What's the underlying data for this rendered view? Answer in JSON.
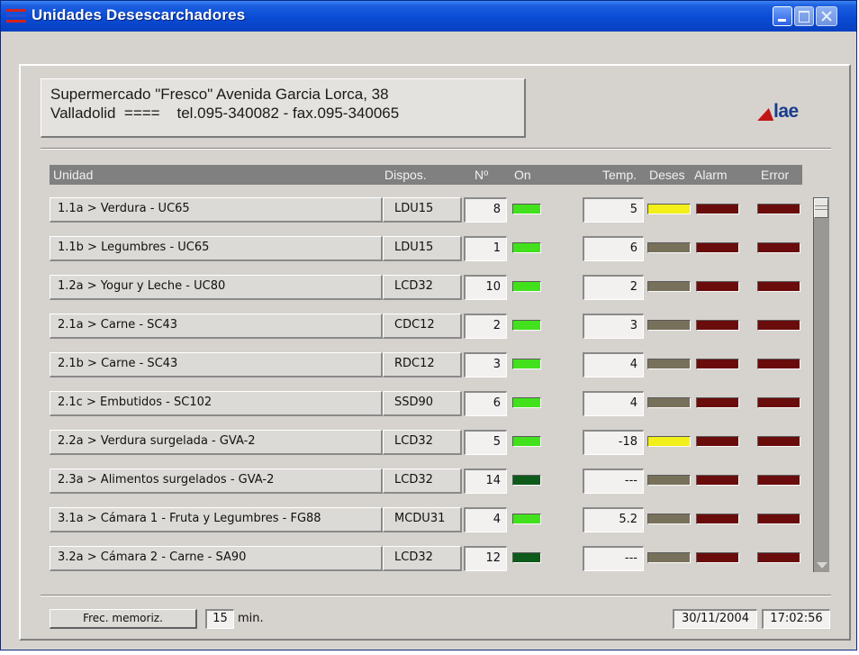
{
  "window": {
    "title": "Unidades Desescarchadores"
  },
  "address": {
    "line1": "Supermercado \"Fresco\" Avenida Garcia Lorca, 38",
    "line2": "Valladolid  ====    tel.095-340082 - fax.095-340065"
  },
  "logo": {
    "text": "lae"
  },
  "header": {
    "unidad": "Unidad",
    "dispos": "Dispos.",
    "num": "Nº",
    "on": "On",
    "temp": "Temp.",
    "deses": "Deses",
    "alarm": "Alarm",
    "error": "Error"
  },
  "colors": {
    "on": "#43e11d",
    "off": "#0d5a1a",
    "deses_on": "#f2ef1a",
    "deses_off": "#77705a",
    "alarm": "#6a0c0c",
    "error": "#6a0c0c"
  },
  "rows": [
    {
      "name": "1.1a > Verdura - UC65",
      "dispos": "LDU15",
      "num": "8",
      "on": true,
      "temp": "5",
      "deses": true
    },
    {
      "name": "1.1b > Legumbres - UC65",
      "dispos": "LDU15",
      "num": "1",
      "on": true,
      "temp": "6",
      "deses": false
    },
    {
      "name": "1.2a > Yogur y Leche - UC80",
      "dispos": "LCD32",
      "num": "10",
      "on": true,
      "temp": "2",
      "deses": false
    },
    {
      "name": "2.1a > Carne - SC43",
      "dispos": "CDC12",
      "num": "2",
      "on": true,
      "temp": "3",
      "deses": false
    },
    {
      "name": "2.1b > Carne - SC43",
      "dispos": "RDC12",
      "num": "3",
      "on": true,
      "temp": "4",
      "deses": false
    },
    {
      "name": "2.1c > Embutidos - SC102",
      "dispos": "SSD90",
      "num": "6",
      "on": true,
      "temp": "4",
      "deses": false
    },
    {
      "name": "2.2a > Verdura surgelada - GVA-2",
      "dispos": "LCD32",
      "num": "5",
      "on": true,
      "temp": "-18",
      "deses": true
    },
    {
      "name": "2.3a > Alimentos surgelados - GVA-2",
      "dispos": "LCD32",
      "num": "14",
      "on": false,
      "temp": "---",
      "deses": false
    },
    {
      "name": "3.1a > Cámara 1 - Fruta y Legumbres - FG88",
      "dispos": "MCDU31",
      "num": "4",
      "on": true,
      "temp": "5.2",
      "deses": false
    },
    {
      "name": "3.2a > Cámara 2 - Carne - SA90",
      "dispos": "LCD32",
      "num": "12",
      "on": false,
      "temp": "---",
      "deses": false
    }
  ],
  "footer": {
    "frec_label": "Frec. memoriz.",
    "frec_value": "15",
    "unit": "min.",
    "date": "30/11/2004",
    "time": "17:02:56"
  }
}
